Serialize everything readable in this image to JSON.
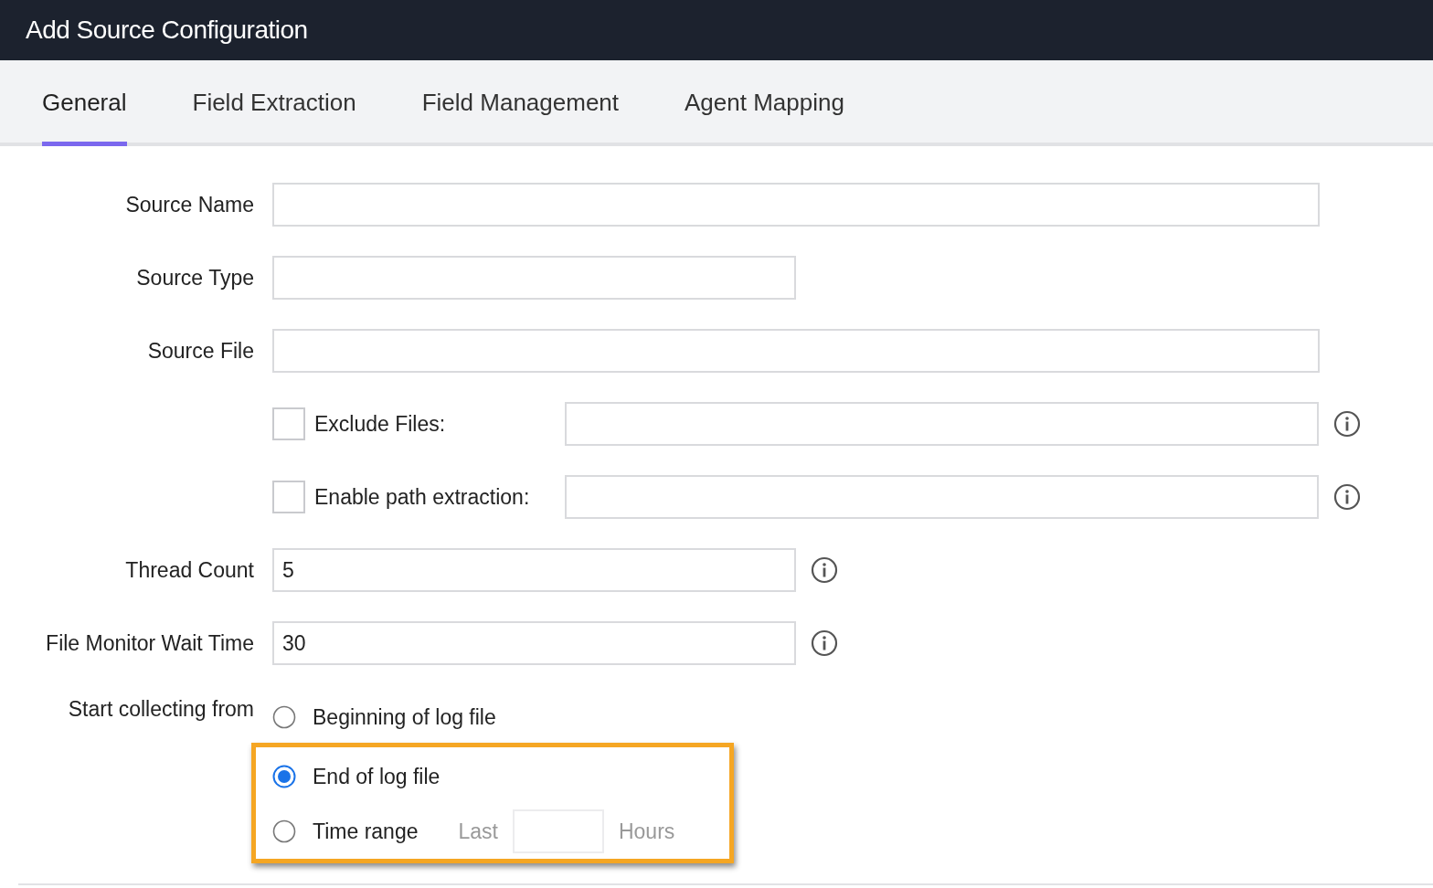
{
  "window": {
    "title": "Add Source Configuration"
  },
  "tabs": [
    {
      "label": "General",
      "selected": true
    },
    {
      "label": "Field Extraction",
      "selected": false
    },
    {
      "label": "Field Management",
      "selected": false
    },
    {
      "label": "Agent Mapping",
      "selected": false
    }
  ],
  "fields": [
    {
      "kind": "wide",
      "label": "Source Name",
      "info": false
    },
    {
      "kind": "narrow",
      "label": "Source Type",
      "info": false
    },
    {
      "kind": "wide",
      "label": "Source File",
      "info": false
    },
    {
      "kind": "checkbox",
      "label": "Exclude Files:",
      "checked": false,
      "info": true
    },
    {
      "kind": "checkbox",
      "label": "Enable path extraction:",
      "checked": false,
      "info": true
    },
    {
      "kind": "narrow",
      "label": "Thread Count",
      "value": "5",
      "info": true
    },
    {
      "kind": "narrow",
      "label": "File Monitor Wait Time",
      "value": "30",
      "info": true
    }
  ],
  "start_collecting": {
    "label": "Start collecting from",
    "options": [
      {
        "label": "Beginning of log file",
        "selected": false,
        "highlighted": false
      },
      {
        "label": "End of log file",
        "selected": true,
        "highlighted": true
      },
      {
        "label": "Time range",
        "selected": false,
        "highlighted": true,
        "prefix": "Last",
        "suffix": "Hours"
      }
    ]
  }
}
